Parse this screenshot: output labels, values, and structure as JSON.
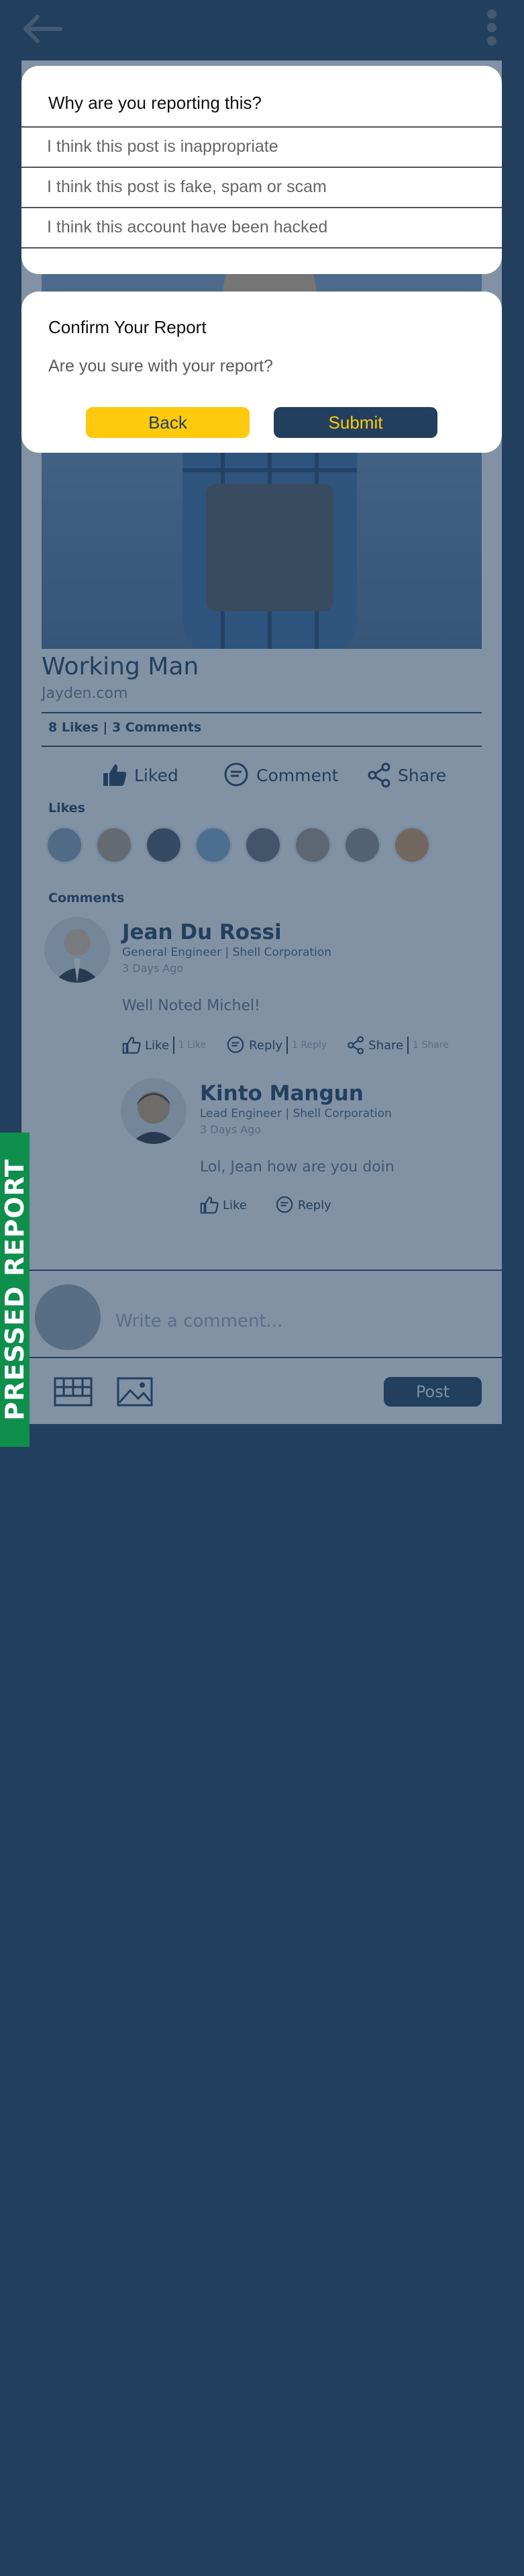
{
  "header": {
    "back_icon": "arrow-left-icon",
    "menu_icon": "kebab-menu-icon"
  },
  "post": {
    "title": "Working Man",
    "author": "Jayden.com",
    "counts": "8 Likes | 3 Comments",
    "actions": {
      "liked": "Liked",
      "comment": "Comment",
      "share": "Share"
    },
    "likes_title": "Likes",
    "comments_title": "Comments"
  },
  "comments": [
    {
      "name": "Jean Du Rossi",
      "role": "General Engineer | Shell Corporation",
      "time": "3 Days Ago",
      "text": "Well Noted Michel!",
      "like": "Like",
      "like_count": "1 Like",
      "reply": "Reply",
      "reply_count": "1 Reply",
      "share": "Share",
      "share_count": "1 Share"
    },
    {
      "name": "Kinto Mangun",
      "role": "Lead Engineer | Shell Corporation",
      "time": "3 Days Ago",
      "text": "Lol, Jean how are you doin",
      "like": "Like",
      "reply": "Reply"
    }
  ],
  "compose": {
    "placeholder": "Write a comment...",
    "post_label": "Post"
  },
  "report_modal": {
    "title": "Why are you reporting this?",
    "reasons": [
      "I think this post is inappropriate",
      "I think this post is fake, spam or scam",
      "I think this account have been hacked"
    ]
  },
  "confirm_modal": {
    "title": "Confirm Your Report",
    "text": "Are you sure with your report?",
    "back_label": "Back",
    "submit_label": "Submit"
  },
  "side_label": "PRESSED REPORT",
  "colors": {
    "navy": "#233f5e",
    "yellow": "#ffc90e",
    "green": "#0f8f4c",
    "white": "#ffffff"
  }
}
